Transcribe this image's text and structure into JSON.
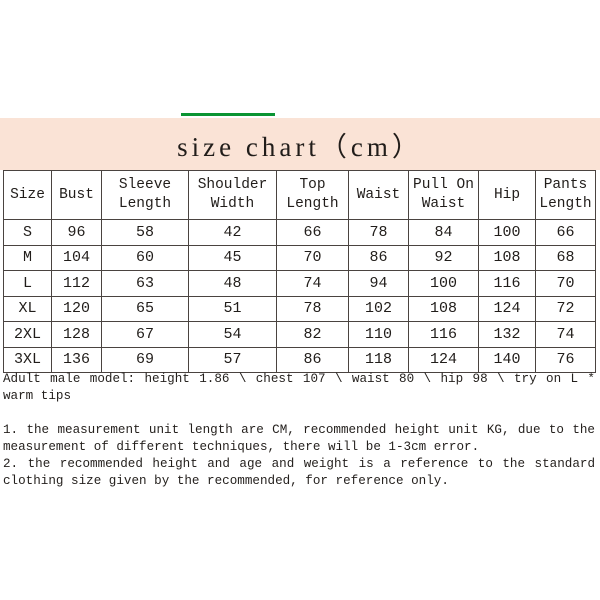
{
  "banner": {
    "title": "size chart（cm）",
    "background_color": "#fae3d6",
    "accent_rule_color": "#0a9433"
  },
  "table": {
    "headers": [
      "Size",
      "Bust",
      "Sleeve Length",
      "Shoulder Width",
      "Top Length",
      "Waist",
      "Pull On Waist",
      "Hip",
      "Pants Length"
    ],
    "rows": [
      {
        "size": "S",
        "bust": "96",
        "sleeve_length": "58",
        "shoulder_width": "42",
        "top_length": "66",
        "waist": "78",
        "pull_on_waist": "84",
        "hip": "100",
        "pants_length": "66"
      },
      {
        "size": "M",
        "bust": "104",
        "sleeve_length": "60",
        "shoulder_width": "45",
        "top_length": "70",
        "waist": "86",
        "pull_on_waist": "92",
        "hip": "108",
        "pants_length": "68"
      },
      {
        "size": "L",
        "bust": "112",
        "sleeve_length": "63",
        "shoulder_width": "48",
        "top_length": "74",
        "waist": "94",
        "pull_on_waist": "100",
        "hip": "116",
        "pants_length": "70"
      },
      {
        "size": "XL",
        "bust": "120",
        "sleeve_length": "65",
        "shoulder_width": "51",
        "top_length": "78",
        "waist": "102",
        "pull_on_waist": "108",
        "hip": "124",
        "pants_length": "72"
      },
      {
        "size": "2XL",
        "bust": "128",
        "sleeve_length": "67",
        "shoulder_width": "54",
        "top_length": "82",
        "waist": "110",
        "pull_on_waist": "116",
        "hip": "132",
        "pants_length": "74"
      },
      {
        "size": "3XL",
        "bust": "136",
        "sleeve_length": "69",
        "shoulder_width": "57",
        "top_length": "86",
        "waist": "118",
        "pull_on_waist": "124",
        "hip": "140",
        "pants_length": "76"
      }
    ]
  },
  "notes": {
    "model": "Adult male model: height 1.86 \\ chest 107 \\ waist 80 \\ hip 98 \\ try on L * warm tips",
    "item1": "1. the measurement unit length are CM, recommended height unit KG, due to the measurement of different techniques, there will be 1-3cm error.",
    "item2": "2. the recommended height and age and weight is a reference to the standard clothing size given by the recommended, for reference only."
  }
}
